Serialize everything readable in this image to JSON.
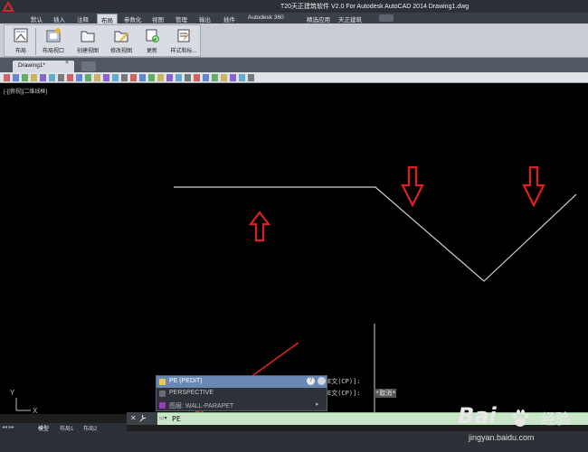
{
  "window": {
    "title": "T20天正建筑软件 V2.0 For Autodesk AutoCAD 2014    Drawing1.dwg"
  },
  "menu": {
    "tabs": [
      {
        "label": "默认",
        "active": false
      },
      {
        "label": "插入",
        "active": false
      },
      {
        "label": "注释",
        "active": false
      },
      {
        "label": "布局",
        "active": true
      },
      {
        "label": "参数化",
        "active": false
      },
      {
        "label": "视图",
        "active": false
      },
      {
        "label": "管理",
        "active": false
      },
      {
        "label": "输出",
        "active": false
      },
      {
        "label": "插件",
        "active": false
      },
      {
        "label": "Autodesk 360",
        "active": false
      },
      {
        "label": "精选应用",
        "active": false
      },
      {
        "label": "天正建筑",
        "active": false
      }
    ]
  },
  "ribbon": {
    "buttons": [
      {
        "label": "布局",
        "icon": "layout-icon"
      },
      {
        "label": "布局视口",
        "icon": "layout-viewport-icon"
      },
      {
        "label": "创建视图",
        "icon": "create-view-icon"
      },
      {
        "label": "修改视图",
        "icon": "edit-view-icon"
      },
      {
        "label": "更新",
        "icon": "update-icon"
      },
      {
        "label": "样式和标...",
        "icon": "styles-icon"
      }
    ]
  },
  "document_tabs": {
    "active": "Drawing1*"
  },
  "viewport": {
    "label": "[-][俯视][二维线框]"
  },
  "autocomplete": {
    "items": [
      {
        "label": "PE (PEDIT)",
        "highlighted": true
      },
      {
        "label": "PERSPECTIVE",
        "highlighted": false
      },
      {
        "label": "图层: WALL-PARAPET",
        "highlighted": false
      }
    ]
  },
  "command_history": {
    "line1": "E文(CP)]:",
    "line2": "E文(CP)]:",
    "option": "*取消*"
  },
  "command_line": {
    "value": "PE"
  },
  "layout_tabs": {
    "items": [
      "模型",
      "布局1",
      "布局2"
    ]
  },
  "watermark": {
    "brand": "Bai",
    "brand_suffix": "经验",
    "url": "jingyan.baidu.com"
  },
  "colors": {
    "annotation_red": "#e02020",
    "cad_background": "#000000",
    "command_line_bg": "#c9e6c9",
    "autocomplete_highlight": "#6a88b4"
  }
}
